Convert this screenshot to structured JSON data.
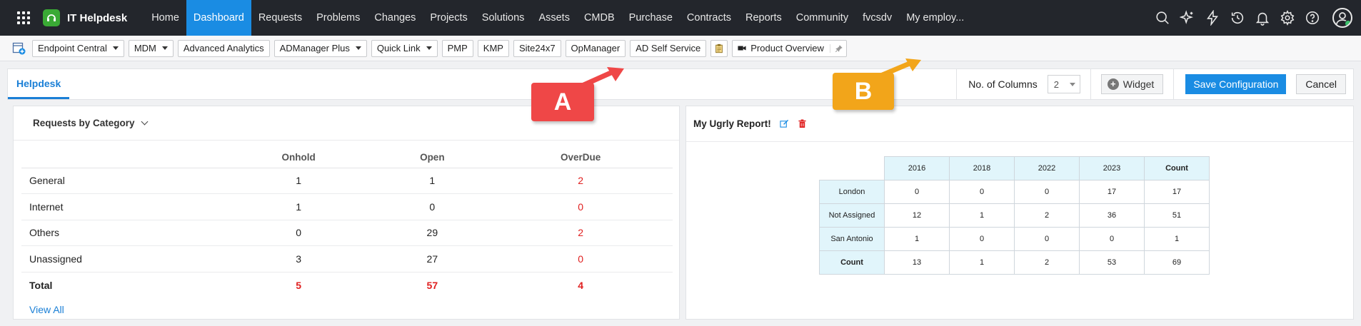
{
  "app": {
    "title": "IT Helpdesk"
  },
  "nav": [
    {
      "label": "Home"
    },
    {
      "label": "Dashboard",
      "active": true
    },
    {
      "label": "Requests"
    },
    {
      "label": "Problems"
    },
    {
      "label": "Changes"
    },
    {
      "label": "Projects"
    },
    {
      "label": "Solutions"
    },
    {
      "label": "Assets"
    },
    {
      "label": "CMDB"
    },
    {
      "label": "Purchase"
    },
    {
      "label": "Contracts"
    },
    {
      "label": "Reports"
    },
    {
      "label": "Community"
    },
    {
      "label": "fvcsdv"
    },
    {
      "label": "My employ..."
    }
  ],
  "nav_icons": [
    "search-icon",
    "ai-sparkle-icon",
    "lightning-icon",
    "history-icon",
    "bell-icon",
    "gear-icon",
    "help-icon",
    "user-avatar-icon"
  ],
  "quicklinks": {
    "items": [
      {
        "label": "Endpoint Central",
        "dropdown": true
      },
      {
        "label": "MDM",
        "dropdown": true
      },
      {
        "label": "Advanced Analytics",
        "dropdown": false
      },
      {
        "label": "ADManager Plus",
        "dropdown": true
      },
      {
        "label": "Quick Link",
        "dropdown": true
      },
      {
        "label": "PMP",
        "dropdown": false
      },
      {
        "label": "KMP",
        "dropdown": false
      },
      {
        "label": "Site24x7",
        "dropdown": false
      },
      {
        "label": "OpManager",
        "dropdown": false
      },
      {
        "label": "AD Self Service",
        "dropdown": false
      }
    ],
    "product_overview": "Product Overview"
  },
  "dashboard": {
    "tab": "Helpdesk",
    "columns_label": "No. of Columns",
    "columns_value": "2",
    "widget_label": "Widget",
    "save_label": "Save Configuration",
    "cancel_label": "Cancel"
  },
  "requests_widget": {
    "title": "Requests by Category",
    "headers": [
      "Onhold",
      "Open",
      "OverDue"
    ],
    "rows": [
      {
        "label": "General",
        "onhold": "1",
        "open": "1",
        "overdue": "2"
      },
      {
        "label": "Internet",
        "onhold": "1",
        "open": "0",
        "overdue": "0"
      },
      {
        "label": "Others",
        "onhold": "0",
        "open": "29",
        "overdue": "2"
      },
      {
        "label": "Unassigned",
        "onhold": "3",
        "open": "27",
        "overdue": "0"
      }
    ],
    "total": {
      "label": "Total",
      "onhold": "5",
      "open": "57",
      "overdue": "4"
    },
    "view_all": "View All"
  },
  "report_widget": {
    "title": "My Ugrly Report!",
    "columns": [
      "2016",
      "2018",
      "2022",
      "2023",
      "Count"
    ],
    "rows": [
      {
        "label": "London",
        "values": [
          "0",
          "0",
          "0",
          "17",
          "17"
        ]
      },
      {
        "label": "Not Assigned",
        "values": [
          "12",
          "1",
          "2",
          "36",
          "51"
        ]
      },
      {
        "label": "San Antonio",
        "values": [
          "1",
          "0",
          "0",
          "0",
          "1"
        ]
      }
    ],
    "total": {
      "label": "Count",
      "values": [
        "13",
        "1",
        "2",
        "53",
        "69"
      ]
    }
  },
  "callouts": {
    "a": "A",
    "b": "B"
  },
  "colors": {
    "nav_bg": "#23262c",
    "accent": "#1a8ce3",
    "overdue": "#e02020",
    "callout_a": "#ef4747",
    "callout_b": "#f2a51a"
  }
}
